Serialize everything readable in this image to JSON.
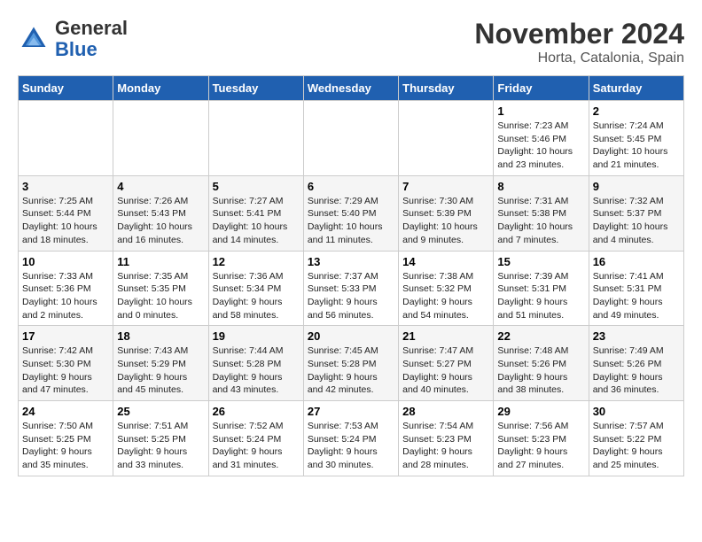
{
  "header": {
    "logo_general": "General",
    "logo_blue": "Blue",
    "month_title": "November 2024",
    "location": "Horta, Catalonia, Spain"
  },
  "days_of_week": [
    "Sunday",
    "Monday",
    "Tuesday",
    "Wednesday",
    "Thursday",
    "Friday",
    "Saturday"
  ],
  "weeks": [
    [
      {
        "day": "",
        "info": ""
      },
      {
        "day": "",
        "info": ""
      },
      {
        "day": "",
        "info": ""
      },
      {
        "day": "",
        "info": ""
      },
      {
        "day": "",
        "info": ""
      },
      {
        "day": "1",
        "info": "Sunrise: 7:23 AM\nSunset: 5:46 PM\nDaylight: 10 hours\nand 23 minutes."
      },
      {
        "day": "2",
        "info": "Sunrise: 7:24 AM\nSunset: 5:45 PM\nDaylight: 10 hours\nand 21 minutes."
      }
    ],
    [
      {
        "day": "3",
        "info": "Sunrise: 7:25 AM\nSunset: 5:44 PM\nDaylight: 10 hours\nand 18 minutes."
      },
      {
        "day": "4",
        "info": "Sunrise: 7:26 AM\nSunset: 5:43 PM\nDaylight: 10 hours\nand 16 minutes."
      },
      {
        "day": "5",
        "info": "Sunrise: 7:27 AM\nSunset: 5:41 PM\nDaylight: 10 hours\nand 14 minutes."
      },
      {
        "day": "6",
        "info": "Sunrise: 7:29 AM\nSunset: 5:40 PM\nDaylight: 10 hours\nand 11 minutes."
      },
      {
        "day": "7",
        "info": "Sunrise: 7:30 AM\nSunset: 5:39 PM\nDaylight: 10 hours\nand 9 minutes."
      },
      {
        "day": "8",
        "info": "Sunrise: 7:31 AM\nSunset: 5:38 PM\nDaylight: 10 hours\nand 7 minutes."
      },
      {
        "day": "9",
        "info": "Sunrise: 7:32 AM\nSunset: 5:37 PM\nDaylight: 10 hours\nand 4 minutes."
      }
    ],
    [
      {
        "day": "10",
        "info": "Sunrise: 7:33 AM\nSunset: 5:36 PM\nDaylight: 10 hours\nand 2 minutes."
      },
      {
        "day": "11",
        "info": "Sunrise: 7:35 AM\nSunset: 5:35 PM\nDaylight: 10 hours\nand 0 minutes."
      },
      {
        "day": "12",
        "info": "Sunrise: 7:36 AM\nSunset: 5:34 PM\nDaylight: 9 hours\nand 58 minutes."
      },
      {
        "day": "13",
        "info": "Sunrise: 7:37 AM\nSunset: 5:33 PM\nDaylight: 9 hours\nand 56 minutes."
      },
      {
        "day": "14",
        "info": "Sunrise: 7:38 AM\nSunset: 5:32 PM\nDaylight: 9 hours\nand 54 minutes."
      },
      {
        "day": "15",
        "info": "Sunrise: 7:39 AM\nSunset: 5:31 PM\nDaylight: 9 hours\nand 51 minutes."
      },
      {
        "day": "16",
        "info": "Sunrise: 7:41 AM\nSunset: 5:31 PM\nDaylight: 9 hours\nand 49 minutes."
      }
    ],
    [
      {
        "day": "17",
        "info": "Sunrise: 7:42 AM\nSunset: 5:30 PM\nDaylight: 9 hours\nand 47 minutes."
      },
      {
        "day": "18",
        "info": "Sunrise: 7:43 AM\nSunset: 5:29 PM\nDaylight: 9 hours\nand 45 minutes."
      },
      {
        "day": "19",
        "info": "Sunrise: 7:44 AM\nSunset: 5:28 PM\nDaylight: 9 hours\nand 43 minutes."
      },
      {
        "day": "20",
        "info": "Sunrise: 7:45 AM\nSunset: 5:28 PM\nDaylight: 9 hours\nand 42 minutes."
      },
      {
        "day": "21",
        "info": "Sunrise: 7:47 AM\nSunset: 5:27 PM\nDaylight: 9 hours\nand 40 minutes."
      },
      {
        "day": "22",
        "info": "Sunrise: 7:48 AM\nSunset: 5:26 PM\nDaylight: 9 hours\nand 38 minutes."
      },
      {
        "day": "23",
        "info": "Sunrise: 7:49 AM\nSunset: 5:26 PM\nDaylight: 9 hours\nand 36 minutes."
      }
    ],
    [
      {
        "day": "24",
        "info": "Sunrise: 7:50 AM\nSunset: 5:25 PM\nDaylight: 9 hours\nand 35 minutes."
      },
      {
        "day": "25",
        "info": "Sunrise: 7:51 AM\nSunset: 5:25 PM\nDaylight: 9 hours\nand 33 minutes."
      },
      {
        "day": "26",
        "info": "Sunrise: 7:52 AM\nSunset: 5:24 PM\nDaylight: 9 hours\nand 31 minutes."
      },
      {
        "day": "27",
        "info": "Sunrise: 7:53 AM\nSunset: 5:24 PM\nDaylight: 9 hours\nand 30 minutes."
      },
      {
        "day": "28",
        "info": "Sunrise: 7:54 AM\nSunset: 5:23 PM\nDaylight: 9 hours\nand 28 minutes."
      },
      {
        "day": "29",
        "info": "Sunrise: 7:56 AM\nSunset: 5:23 PM\nDaylight: 9 hours\nand 27 minutes."
      },
      {
        "day": "30",
        "info": "Sunrise: 7:57 AM\nSunset: 5:22 PM\nDaylight: 9 hours\nand 25 minutes."
      }
    ]
  ]
}
